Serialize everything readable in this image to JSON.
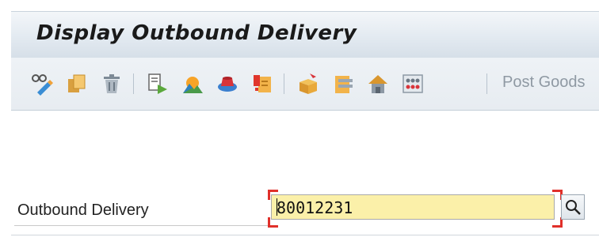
{
  "window": {
    "title": "Display Outbound Delivery"
  },
  "toolbar": {
    "items": [
      {
        "icon": "display-change-icon"
      },
      {
        "icon": "create-copy-icon"
      },
      {
        "icon": "delete-icon"
      },
      {
        "icon": "other-delivery-icon"
      },
      {
        "icon": "header-overview-icon"
      },
      {
        "icon": "item-details-icon"
      },
      {
        "icon": "messages-icon"
      },
      {
        "icon": "pick-icon"
      },
      {
        "icon": "packing-icon"
      },
      {
        "icon": "warehouse-icon"
      },
      {
        "icon": "status-overview-icon"
      }
    ],
    "post_goods_label": "Post Goods"
  },
  "form": {
    "outbound_delivery_label": "Outbound Delivery",
    "outbound_delivery_value": "80012231"
  },
  "colors": {
    "input_background": "#fbf0a9",
    "focus_corners": "#e0302a",
    "title_bar": "#e3eaf1"
  }
}
